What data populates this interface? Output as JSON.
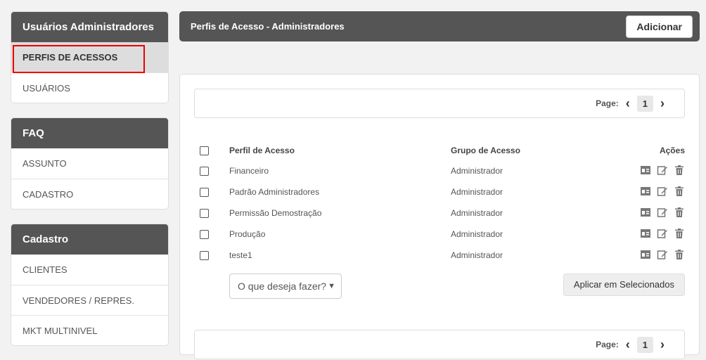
{
  "sidebar": {
    "blocks": [
      {
        "title": "Usuários Administradores",
        "items": [
          "PERFIS DE ACESSOS",
          "USUÁRIOS"
        ]
      },
      {
        "title": "FAQ",
        "items": [
          "ASSUNTO",
          "CADASTRO"
        ]
      },
      {
        "title": "Cadastro",
        "items": [
          "CLIENTES",
          "VENDEDORES / REPRES.",
          "MKT MULTINIVEL"
        ]
      }
    ]
  },
  "header": {
    "title": "Perfis de Acesso - Administradores",
    "add_label": "Adicionar"
  },
  "pager": {
    "label": "Page:",
    "current": "1"
  },
  "table": {
    "headers": {
      "perfil": "Perfil de Acesso",
      "grupo": "Grupo de Acesso",
      "acoes": "Ações"
    },
    "rows": [
      {
        "perfil": "Financeiro",
        "grupo": "Administrador"
      },
      {
        "perfil": "Padrão Administradores",
        "grupo": "Administrador"
      },
      {
        "perfil": "Permissão Demostração",
        "grupo": "Administrador"
      },
      {
        "perfil": "Produção",
        "grupo": "Administrador"
      },
      {
        "perfil": "teste1",
        "grupo": "Administrador"
      }
    ]
  },
  "bulk_actions": {
    "selected": "O que deseja fazer?",
    "apply_label": "Aplicar em Selecionados"
  },
  "colors": {
    "header_bg": "#555555",
    "highlight": "#ee0000",
    "active_item_bg": "#dddddd"
  }
}
